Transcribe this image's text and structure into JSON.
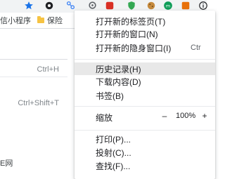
{
  "bookmarks": {
    "items": [
      {
        "label": "信小程序",
        "icon": "folder-icon"
      },
      {
        "label": "保险",
        "icon": "folder-icon"
      }
    ]
  },
  "toolbar": {
    "star_icon": "bookmark-star-icon"
  },
  "background_panel": {
    "shortcut_history": "Ctrl+H",
    "shortcut_downloads": "Ctrl+Shift+T",
    "bottom_text": "E网"
  },
  "menu": {
    "new_tab": {
      "label": "打开新的标签页(T)",
      "shortcut": ""
    },
    "new_window": {
      "label": "打开新的窗口(N)",
      "shortcut": ""
    },
    "incognito": {
      "label": "打开新的隐身窗口(I)",
      "shortcut": "Ctr"
    },
    "history": {
      "label": "历史记录(H)"
    },
    "downloads": {
      "label": "下载内容(D)"
    },
    "bookmarks": {
      "label": "书签(B)"
    },
    "zoom": {
      "label": "缩放",
      "minus": "–",
      "value": "100%",
      "plus": "+"
    },
    "print": {
      "label": "打印(P)..."
    },
    "cast": {
      "label": "投射(C)..."
    },
    "find": {
      "label": "查找(F)..."
    }
  },
  "colors": {
    "highlight": "#e8e8e8",
    "accent_blue": "#1a73e8",
    "folder_yellow": "#f6c343"
  }
}
